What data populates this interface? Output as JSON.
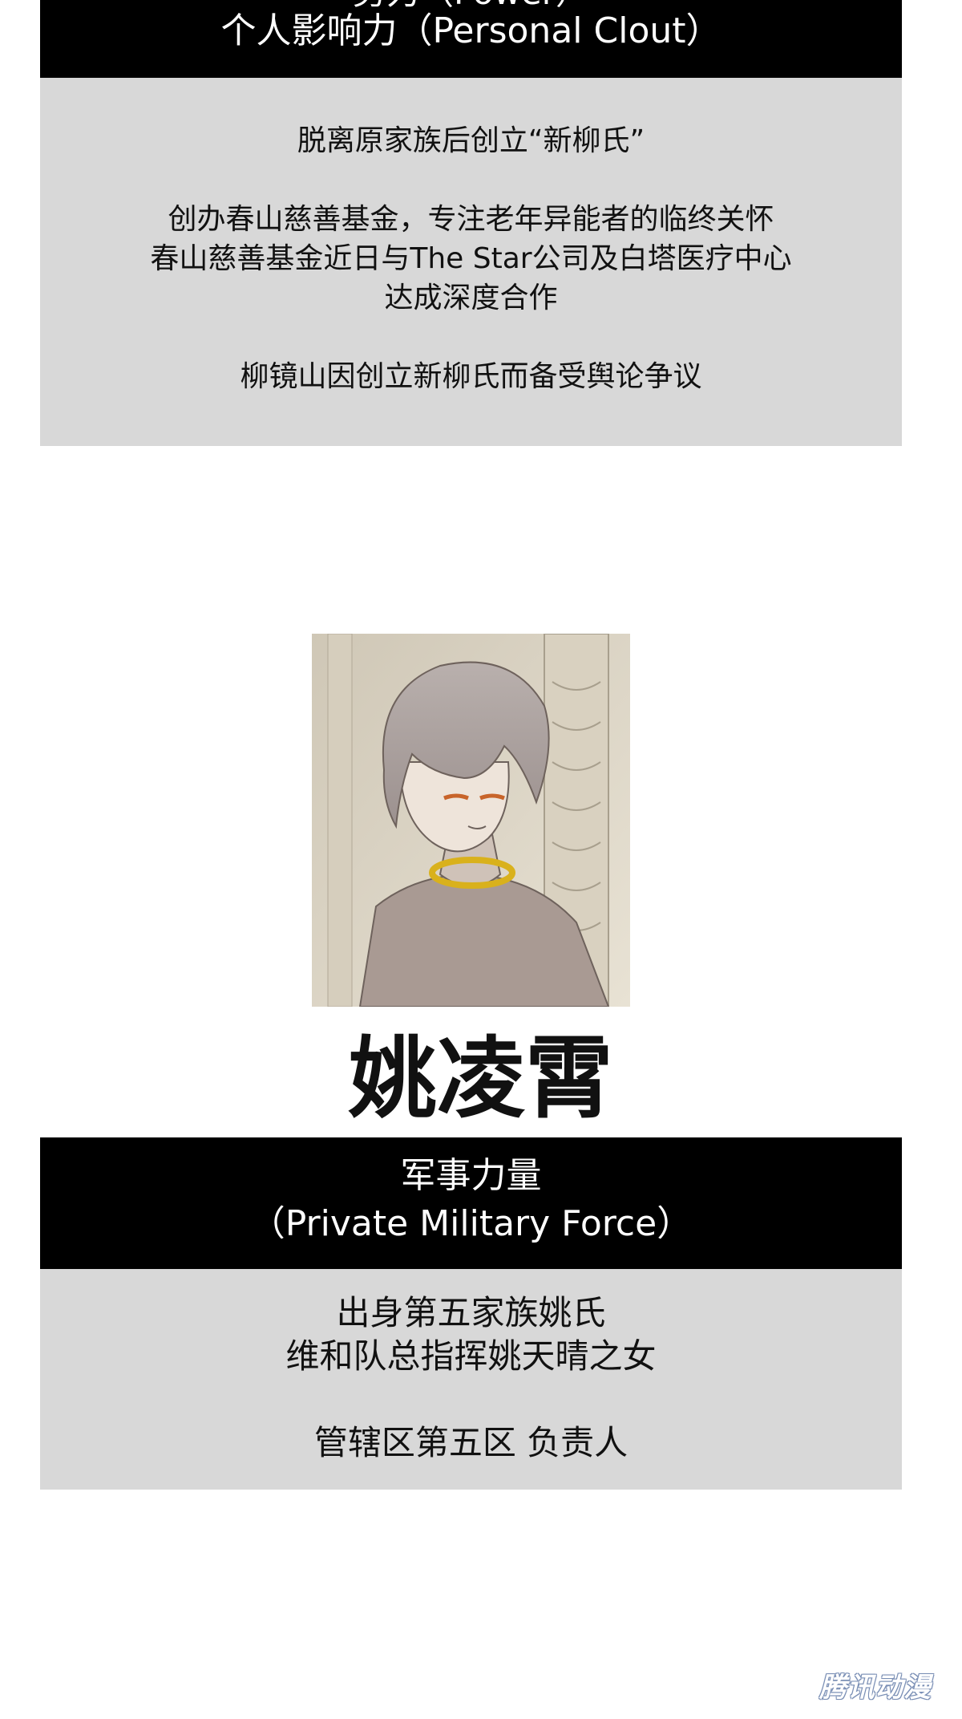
{
  "section1": {
    "title_cut": "势力（Power）",
    "subtitle": "个人影响力（Personal Clout）",
    "lines": [
      "脱离原家族后创立“新柳氏”",
      "",
      "创办春山慈善基金，专注老年异能者的临终关怀",
      "春山慈善基金近日与The Star公司及白塔医疗中心",
      "达成深度合作",
      "",
      "柳镜山因创立新柳氏而备受舆论争议"
    ]
  },
  "character": {
    "name": "姚凌霄",
    "portrait_icon": "character-portrait"
  },
  "section2": {
    "title": "军事力量",
    "subtitle": "（Private Military Force）",
    "lines": [
      "出身第五家族姚氏",
      "维和队总指挥姚天晴之女",
      "",
      "管辖区第五区 负责人"
    ]
  },
  "watermark": "腾讯动漫"
}
